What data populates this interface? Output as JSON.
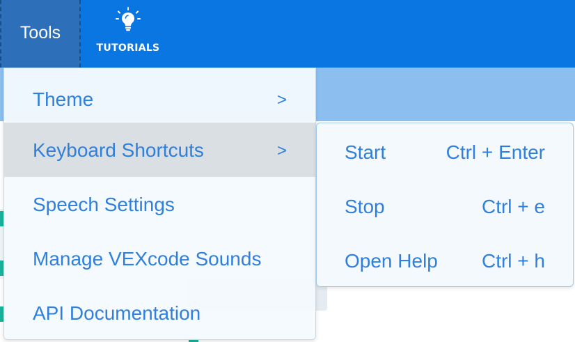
{
  "topbar": {
    "tools_label": "Tools",
    "tutorials_label": "TUTORIALS",
    "tutorials_icon": "lightbulb-icon",
    "bar_color": "#0a76e2"
  },
  "menu": {
    "items": [
      {
        "label": "Theme",
        "arrow": ">"
      },
      {
        "label": "Keyboard Shortcuts",
        "arrow": ">"
      },
      {
        "label": "Speech Settings"
      },
      {
        "label": "Manage VEXcode Sounds"
      },
      {
        "label": "API Documentation"
      }
    ],
    "active_item": "Keyboard Shortcuts",
    "text_color": "#2f7fdd"
  },
  "submenu": {
    "items": [
      {
        "name": "Start",
        "shortcut": "Ctrl + Enter"
      },
      {
        "name": "Stop",
        "shortcut": "Ctrl + e"
      },
      {
        "name": "Open Help",
        "shortcut": "Ctrl + h"
      }
    ]
  }
}
